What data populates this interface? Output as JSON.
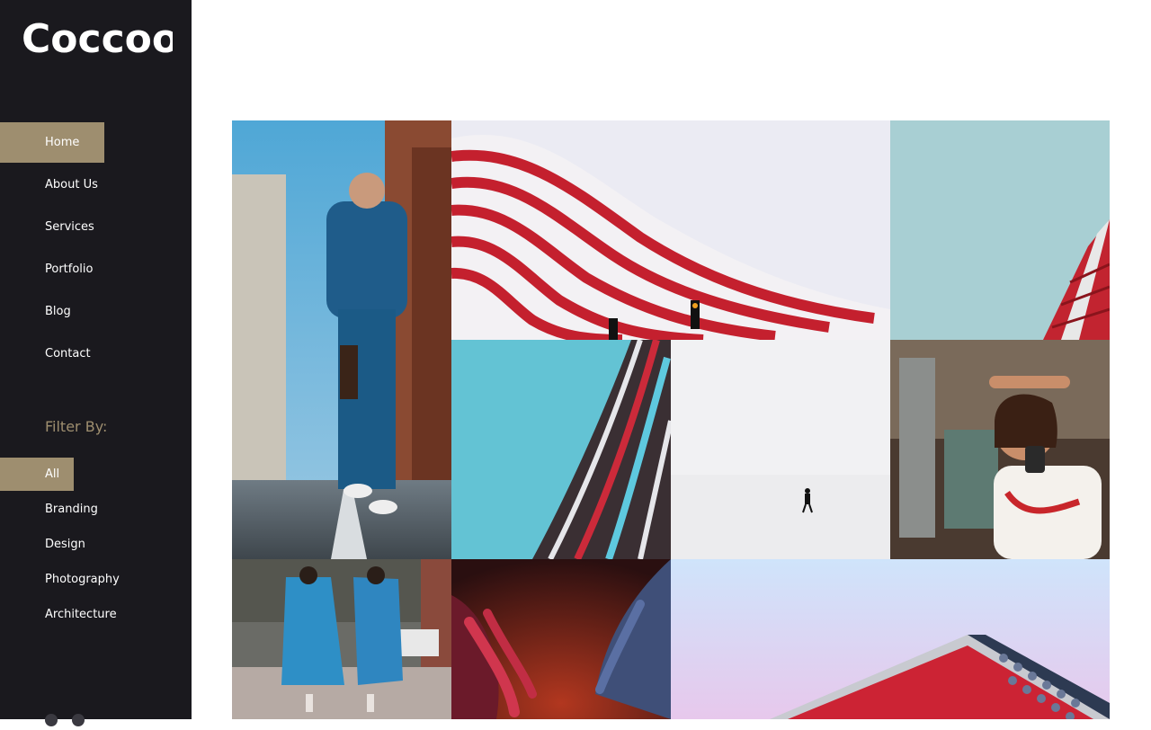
{
  "brand": {
    "logo": "Coccoon"
  },
  "nav": {
    "items": [
      {
        "label": "Home",
        "active": true
      },
      {
        "label": "About Us",
        "active": false
      },
      {
        "label": "Services",
        "active": false
      },
      {
        "label": "Portfolio",
        "active": false
      },
      {
        "label": "Blog",
        "active": false
      },
      {
        "label": "Contact",
        "active": false
      }
    ]
  },
  "filter": {
    "title": "Filter By:",
    "items": [
      {
        "label": "All",
        "active": true
      },
      {
        "label": "Branding",
        "active": false
      },
      {
        "label": "Design",
        "active": false
      },
      {
        "label": "Photography",
        "active": false
      },
      {
        "label": "Architecture",
        "active": false
      }
    ]
  },
  "colors": {
    "sidebar": "#1a191e",
    "accent": "#9e8e6f",
    "text": "#ffffff"
  },
  "social": {
    "icons": [
      "social-icon-1",
      "social-icon-2"
    ]
  },
  "gallery": {
    "images": [
      {
        "subject": "man walking street portrait"
      },
      {
        "subject": "red white striped building"
      },
      {
        "subject": "red facade sky"
      },
      {
        "subject": "teal glass building curve"
      },
      {
        "subject": "person walking in fog"
      },
      {
        "subject": "woman with braids portrait"
      },
      {
        "subject": "two women patterned outfits"
      },
      {
        "subject": "hands red light"
      },
      {
        "subject": "pink sky angular building"
      }
    ]
  }
}
